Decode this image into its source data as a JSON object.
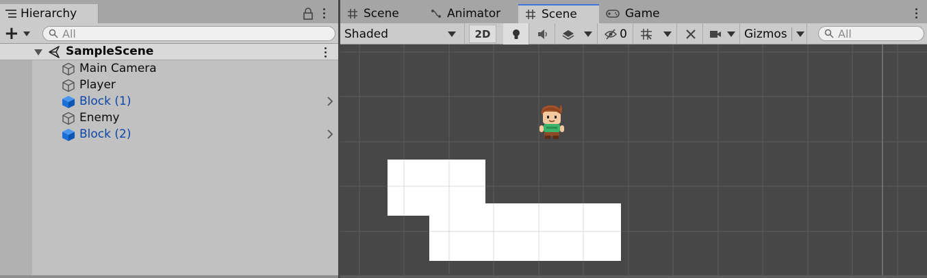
{
  "hierarchy": {
    "tab_title": "Hierarchy",
    "search_placeholder": "All",
    "scene_name": "SampleScene",
    "items": [
      {
        "label": "Main Camera",
        "type": "gameobject"
      },
      {
        "label": "Player",
        "type": "gameobject"
      },
      {
        "label": "Block (1)",
        "type": "prefab"
      },
      {
        "label": "Enemy",
        "type": "gameobject"
      },
      {
        "label": "Block (2)",
        "type": "prefab"
      }
    ]
  },
  "scene_panel": {
    "tabs": [
      {
        "label": "Scene",
        "icon": "grid-icon",
        "active": false
      },
      {
        "label": "Animator",
        "icon": "animator-icon",
        "active": false
      },
      {
        "label": "Scene",
        "icon": "grid-icon",
        "active": true
      },
      {
        "label": "Game",
        "icon": "gamepad-icon",
        "active": false
      }
    ],
    "toolbar": {
      "shading_mode": "Shaded",
      "mode_2d_label": "2D",
      "hidden_count": "0",
      "gizmos_label": "Gizmos",
      "search_placeholder": "All"
    }
  },
  "colors": {
    "panel_bg": "#c1c1c1",
    "viewport_bg": "#474747",
    "prefab_text": "#0b46a8",
    "active_tab_accent": "#3a72d8",
    "prefab_icon": "#1b6ed6"
  }
}
